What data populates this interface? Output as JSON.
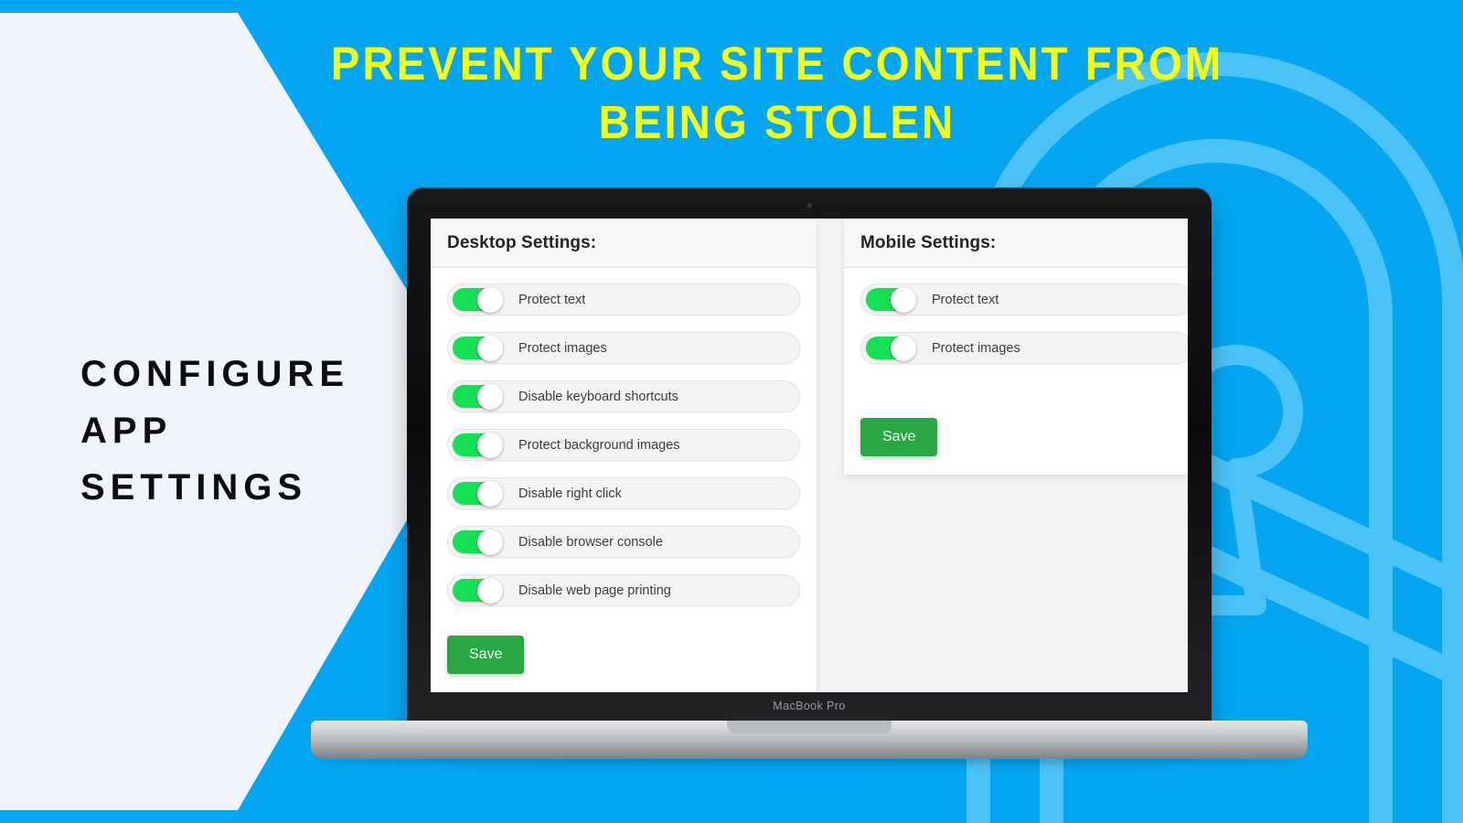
{
  "colors": {
    "background_blue": "#04a6f2",
    "panel_light": "#f2f4fb",
    "headline_yellow": "#f5ff16",
    "toggle_green": "#14e054",
    "save_green": "#28a745",
    "decoration_blue": "#4cc3f7"
  },
  "headline": {
    "text": "PREVENT YOUR SITE CONTENT FROM\nBEING STOLEN"
  },
  "left_caption": {
    "text": "CONFIGURE\nAPP\nSETTINGS"
  },
  "device": {
    "model_label": "MacBook Pro"
  },
  "app": {
    "desktop_panel": {
      "title": "Desktop Settings:",
      "toggles": [
        {
          "label": "Protect text",
          "state": "on"
        },
        {
          "label": "Protect images",
          "state": "on"
        },
        {
          "label": "Disable keyboard shortcuts",
          "state": "on"
        },
        {
          "label": "Protect background images",
          "state": "on"
        },
        {
          "label": "Disable right click",
          "state": "on"
        },
        {
          "label": "Disable browser console",
          "state": "on"
        },
        {
          "label": "Disable web page printing",
          "state": "on"
        }
      ],
      "save_label": "Save"
    },
    "mobile_panel": {
      "title": "Mobile Settings:",
      "toggles": [
        {
          "label": "Protect text",
          "state": "on"
        },
        {
          "label": "Protect images",
          "state": "on"
        }
      ],
      "save_label": "Save"
    }
  }
}
